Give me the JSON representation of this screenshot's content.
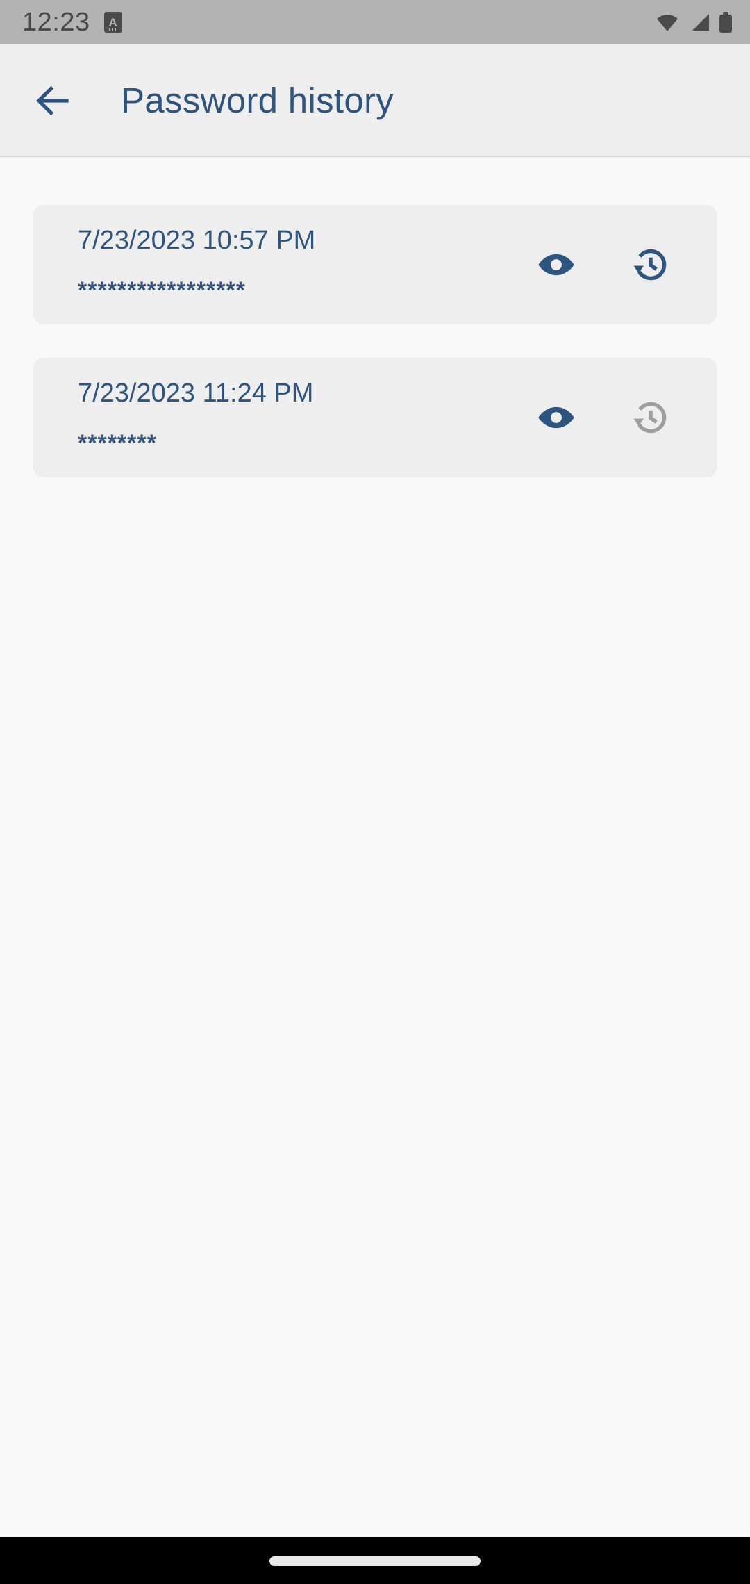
{
  "status_bar": {
    "time": "12:23",
    "app_badge_letter": "A",
    "icons": [
      "app-badge-icon",
      "wifi-icon",
      "cellular-signal-icon",
      "battery-icon"
    ]
  },
  "app_bar": {
    "back_label": "back-arrow-icon",
    "title": "Password history"
  },
  "theme": {
    "accent": "#2d5580",
    "password_text": "#33557d",
    "card_bg": "#eeeeee",
    "page_bg": "#f9f9f9",
    "appbar_bg": "#eeeeee",
    "statusbar_bg": "#b3b3b3",
    "disabled_icon": "#9e9e9e",
    "navbar_bg": "#000000"
  },
  "history": {
    "items": [
      {
        "date": "7/23/2023 10:57 PM",
        "password_masked": "*****************",
        "view_icon": "eye-icon",
        "view_enabled": true,
        "restore_icon": "restore-history-icon",
        "restore_enabled": true
      },
      {
        "date": "7/23/2023 11:24 PM",
        "password_masked": "********",
        "view_icon": "eye-icon",
        "view_enabled": true,
        "restore_icon": "restore-history-icon",
        "restore_enabled": false
      }
    ]
  },
  "nav_bar": {
    "handle": "gesture-home-pill"
  }
}
